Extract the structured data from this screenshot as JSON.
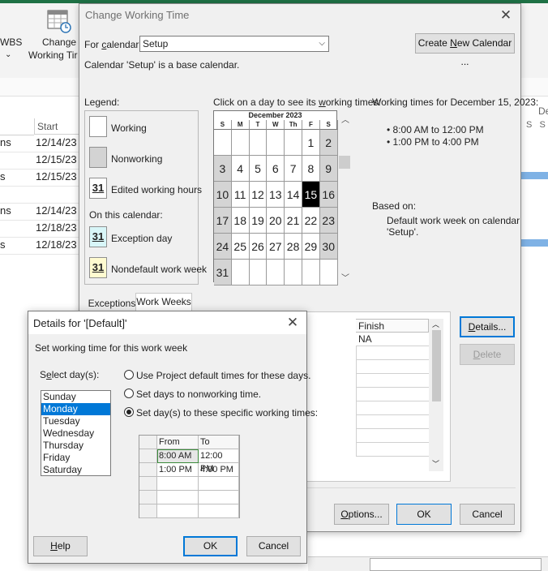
{
  "ribbon": {
    "wbs_label": "WBS",
    "change_label_line1": "Change",
    "change_label_line2": "Working Tir"
  },
  "grid": {
    "start_header": "Start",
    "names": [
      "ns",
      "",
      "s",
      "",
      "ns",
      "",
      "s"
    ],
    "dates": [
      "12/14/23",
      "12/15/23",
      "12/15/23",
      "",
      "12/14/23",
      "12/18/23",
      "12/18/23"
    ]
  },
  "right_strip": {
    "col_header": "De",
    "sub_header": "S   S"
  },
  "main_dialog": {
    "title": "Change Working Time",
    "for_calendar_label": "For calendar:",
    "calendar_value": "Setup",
    "create_new_calendar_button": "Create New Calendar ...",
    "base_note": "Calendar 'Setup' is a base calendar.",
    "legend_title": "Legend:",
    "legend": {
      "working": "Working",
      "nonworking": "Nonworking",
      "edited_num": "31",
      "edited": "Edited working hours",
      "on_this_calendar": "On this calendar:",
      "exception_num": "31",
      "exception": "Exception day",
      "nondefault_num": "31",
      "nondefault": "Nondefault work week"
    },
    "calendar_instructions": "Click on a day to see its working times:",
    "calendar": {
      "month_title": "December 2023",
      "weekdays": [
        "S",
        "M",
        "T",
        "W",
        "Th",
        "F",
        "S"
      ],
      "rows": [
        [
          "",
          "",
          "",
          "",
          "",
          "1",
          "2"
        ],
        [
          "3",
          "4",
          "5",
          "6",
          "7",
          "8",
          "9"
        ],
        [
          "10",
          "11",
          "12",
          "13",
          "14",
          "15",
          "16"
        ],
        [
          "17",
          "18",
          "19",
          "20",
          "21",
          "22",
          "23"
        ],
        [
          "24",
          "25",
          "26",
          "27",
          "28",
          "29",
          "30"
        ],
        [
          "31",
          "",
          "",
          "",
          "",
          "",
          ""
        ]
      ],
      "selected_day": "15"
    },
    "working_times_title": "Working times for December 15, 2023:",
    "working_times": [
      "8:00 AM to 12:00 PM",
      "1:00 PM to 4:00 PM"
    ],
    "based_on_label": "Based on:",
    "based_on_text_line1": "Default work week on calendar",
    "based_on_text_line2": "'Setup'.",
    "tabs": [
      "Exceptions",
      "Work Weeks"
    ],
    "table_header_finish": "Finish",
    "table_finish_value": "NA",
    "details_button": "Details...",
    "delete_button": "Delete",
    "options_button": "Options...",
    "ok_button": "OK",
    "cancel_button": "Cancel"
  },
  "details_dialog": {
    "title": "Details for '[Default]'",
    "instruction": "Set working time for this work week",
    "select_days_label": "Select day(s):",
    "days": [
      "Sunday",
      "Monday",
      "Tuesday",
      "Wednesday",
      "Thursday",
      "Friday",
      "Saturday"
    ],
    "selected_day": "Monday",
    "radio_default": "Use Project default times for these days.",
    "radio_nonworking": "Set days to nonworking time.",
    "radio_specific": "Set day(s) to these specific working times:",
    "times_header_from": "From",
    "times_header_to": "To",
    "times": [
      {
        "from": "8:00 AM",
        "to": "12:00 PM"
      },
      {
        "from": "1:00 PM",
        "to": "4:00 PM"
      }
    ],
    "help_button": "Help",
    "ok_button": "OK",
    "cancel_button": "Cancel"
  }
}
